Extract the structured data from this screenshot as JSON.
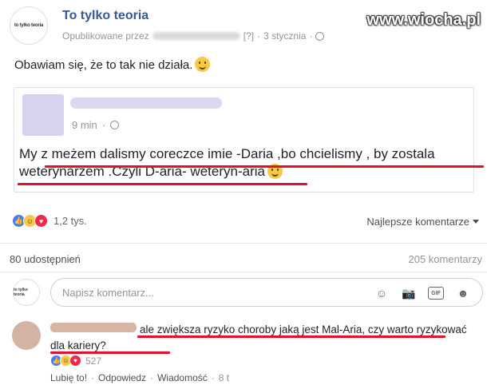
{
  "post": {
    "page_name": "To tylko teoria",
    "logo_text": "to tylko teoria",
    "published_by_label": "Opublikowane przez",
    "bracket": "[?]",
    "date_sep": "·",
    "date": "3 stycznia",
    "meta_sep": "·",
    "text": "Obawiam się, że to tak nie działa."
  },
  "watermark": "www.wiocha.pl",
  "shared": {
    "time": "9 min",
    "sep": "·",
    "text": "My z meżem dalismy coreczce imie -Daria ,bo chcielismy , by zostala weterynarzem .Czyli D-aria- weteryn-aria"
  },
  "reactions": {
    "count": "1,2 tys.",
    "sort_label": "Najlepsze komentarze"
  },
  "stats": {
    "shares": "80 udostępnień",
    "comments": "205 komentarzy"
  },
  "composer": {
    "placeholder": "Napisz komentarz...",
    "avatar_text": "to tylko teoria",
    "gif_label": "GIF"
  },
  "comment": {
    "text": "ale zwiększa ryzyko choroby jaką jest Mal-Aria, czy warto ryzykować dla kariery?",
    "reaction_count": "527",
    "like_label": "Lubię to!",
    "reply_label": "Odpowiedz",
    "message_label": "Wiadomość",
    "time": "8 t",
    "sep": "·"
  },
  "colors": {
    "link": "#365899",
    "highlight_line": "#e3112d",
    "like": "#4a7cf6",
    "love": "#f0284a",
    "haha": "#f7c945"
  }
}
